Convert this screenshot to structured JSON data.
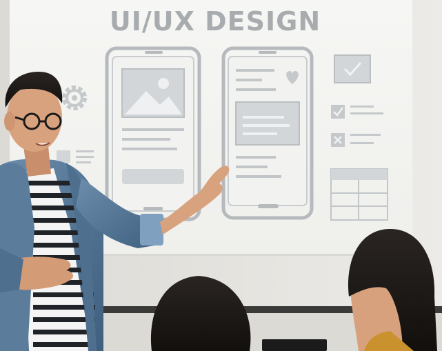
{
  "scene": {
    "slide_title": "UI/UX DESIGN",
    "description_hidden": false
  },
  "colors": {
    "wall": "#e7e5e0",
    "screen": "#f4f4f2",
    "wireframe_stroke": "#b9bdc0",
    "wireframe_fill": "#d3d6d8",
    "denim": "#5f7f9f",
    "skin": "#d9a27e",
    "hair": "#1d1a18",
    "shirt_stripe_dark": "#1f2328",
    "mustard": "#c9922e"
  },
  "icons": [
    "gear-icon",
    "image-placeholder-icon",
    "heart-icon",
    "checkbox-checked-icon",
    "checkbox-cross-icon",
    "table-grid-icon"
  ]
}
